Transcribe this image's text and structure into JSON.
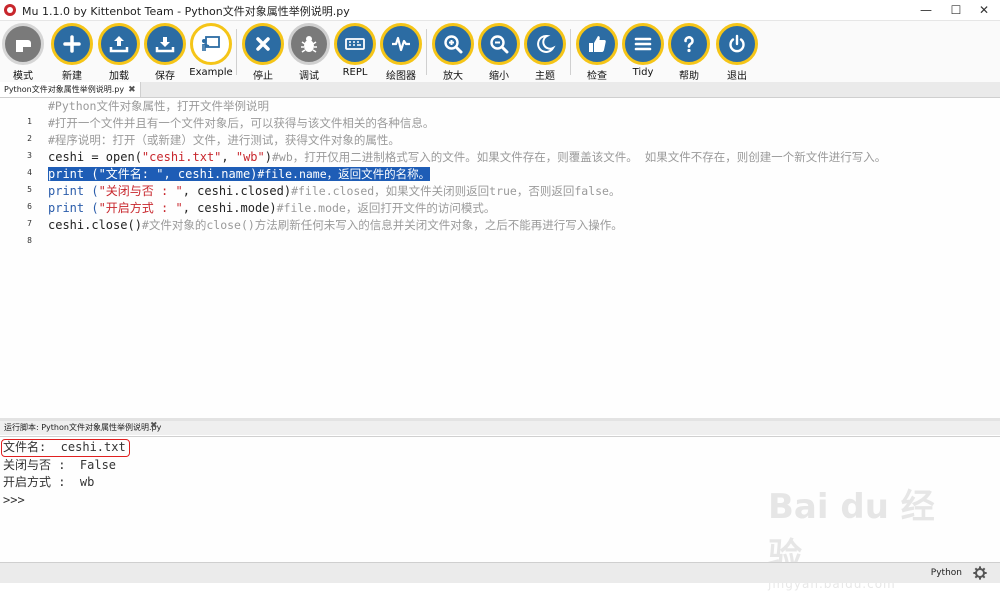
{
  "window": {
    "title": "Mu 1.1.0 by Kittenbot Team - Python文件对象属性举例说明.py",
    "minimize": "—",
    "maximize": "☐",
    "close": "✕"
  },
  "toolbar": {
    "buttons": [
      {
        "label": "模式",
        "icon": "mode-icon"
      },
      {
        "label": "新建",
        "icon": "plus-icon"
      },
      {
        "label": "加载",
        "icon": "upload-icon"
      },
      {
        "label": "保存",
        "icon": "download-icon"
      },
      {
        "label": "Example",
        "icon": "presentation-icon"
      },
      {
        "label": "停止",
        "icon": "close-icon"
      },
      {
        "label": "调试",
        "icon": "bug-icon"
      },
      {
        "label": "REPL",
        "icon": "keyboard-icon"
      },
      {
        "label": "绘图器",
        "icon": "pulse-icon"
      },
      {
        "label": "放大",
        "icon": "zoom-in-icon"
      },
      {
        "label": "缩小",
        "icon": "zoom-out-icon"
      },
      {
        "label": "主题",
        "icon": "moon-icon"
      },
      {
        "label": "检查",
        "icon": "thumbs-up-icon"
      },
      {
        "label": "Tidy",
        "icon": "lines-icon"
      },
      {
        "label": "帮助",
        "icon": "question-icon"
      },
      {
        "label": "退出",
        "icon": "power-icon"
      }
    ]
  },
  "tab": {
    "name": "Python文件对象属性举例说明.py",
    "close": "✖"
  },
  "editor": {
    "line_numbers": [
      "1",
      "2",
      "3",
      "4",
      "5",
      "6",
      "7",
      "8"
    ],
    "lines": [
      "#Python文件对象属性，打开文件举例说明",
      "#打开一个文件并且有一个文件对象后，可以获得与该文件相关的各种信息。",
      "#程序说明：打开（或新建）文件，进行测试，获得文件对象的属性。",
      {
        "a": "ceshi = open(",
        "b": "\"ceshi.txt\"",
        "c": ", ",
        "d": "\"wb\"",
        "e": ")",
        "f": "#wb，打开仅用二进制格式写入的文件。如果文件存在，则覆盖该文件。 如果文件不存在，则创建一个新文件进行写入。"
      },
      {
        "a": "print (",
        "b": "\"文件名: \"",
        "c": ", ceshi.name)",
        "d": "#file.name，返回文件的名称。"
      },
      {
        "a": "print (",
        "b": "\"关闭与否 : \"",
        "c": ", ceshi.closed)",
        "d": "#file.closed，如果文件关闭则返回true，否则返回false。"
      },
      {
        "a": "print (",
        "b": "\"开启方式 : \"",
        "c": ", ceshi.mode)",
        "d": "#file.mode，返回打开文件的访问模式。"
      },
      {
        "a": "ceshi.close()",
        "b": "#文件对象的close()方法刷新任何未写入的信息并关闭文件对象，之后不能再进行写入操作。"
      }
    ]
  },
  "repl": {
    "title": "运行脚本: Python文件对象属性举例说明.py",
    "close": "✖",
    "output": [
      "文件名:  ceshi.txt",
      "关闭与否 :  False",
      "开启方式 :  wb",
      ">>>"
    ]
  },
  "watermark": {
    "logo": "Bai du 经验",
    "url": "jingyan.baidu.com"
  },
  "status": {
    "mode": "Python",
    "settings_icon": "gear-icon"
  },
  "colors": {
    "accent": "#2c6ca3",
    "button_ring": "#f5c518",
    "selection": "#1e5db6",
    "string": "#c8272d",
    "comment": "#9a9a9a",
    "highlight_box": "#e02020"
  }
}
